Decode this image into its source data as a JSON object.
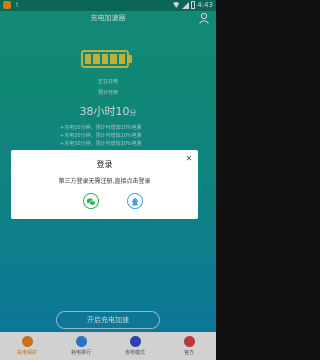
{
  "status_bar": {
    "time": "4:43"
  },
  "header": {
    "title": "充电加速器"
  },
  "battery": {
    "status": "正在充电",
    "estimate_label": "预计可用",
    "segments": 5,
    "color": "#e6d84b"
  },
  "remaining": {
    "hours": "38",
    "hours_unit": "小时",
    "minutes": "10",
    "minutes_unit": "分"
  },
  "tips": [
    "+充电10分钟，预计可增加10%电量",
    "+充电20分钟，预计可增加20%电量",
    "+充电30分钟，预计可增加30%电量"
  ],
  "dialog": {
    "title": "登录",
    "message": "第三方登录无需注册,直接点击登录",
    "close_icon": "close-icon",
    "buttons": [
      {
        "name": "wechat-login-button",
        "icon": "wechat-icon",
        "color": "#2bb24c"
      },
      {
        "name": "qq-login-button",
        "icon": "qq-icon",
        "color": "#3aa2e8"
      }
    ]
  },
  "start_button": {
    "label": "开启充电加速"
  },
  "bottom_nav": [
    {
      "label": "充电保护",
      "icon": "charge-protect-icon",
      "color": "#f28a22",
      "active": true
    },
    {
      "label": "耗电排行",
      "icon": "ranking-icon",
      "color": "#2f8fe8",
      "active": false
    },
    {
      "label": "省电模式",
      "icon": "power-save-icon",
      "color": "#3b4fd8",
      "active": false
    },
    {
      "label": "官方",
      "icon": "official-icon",
      "color": "#e64545",
      "active": false
    }
  ],
  "colors": {
    "accent": "#17a98f",
    "nav_active": "#e38b2b"
  }
}
